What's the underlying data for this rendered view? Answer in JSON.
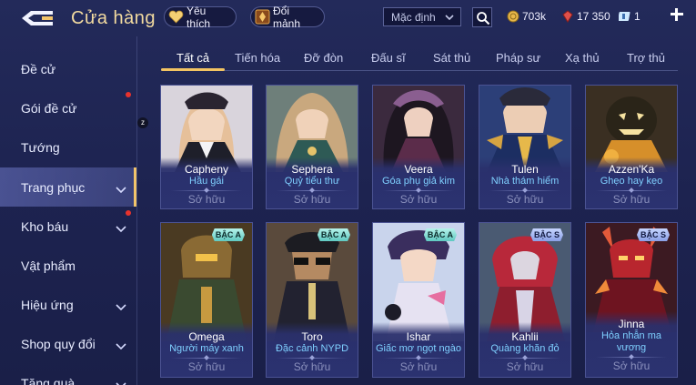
{
  "header": {
    "title": "Cửa hàng",
    "favorites_label": "Yêu thích",
    "exchange_label": "Đổi mảnh",
    "sort_value": "Mặc định",
    "gold": "703k",
    "rubies": "17 350",
    "vouchers": "1"
  },
  "sidebar": {
    "items": [
      {
        "label": "Đề cử"
      },
      {
        "label": "Gói đề cử"
      },
      {
        "label": "Tướng"
      },
      {
        "label": "Trang phục"
      },
      {
        "label": "Kho báu"
      },
      {
        "label": "Vật phẩm"
      },
      {
        "label": "Hiệu ứng"
      },
      {
        "label": "Shop quy đổi"
      },
      {
        "label": "Tặng quà"
      }
    ],
    "z_badge": "z"
  },
  "tabs": [
    {
      "label": "Tất cả"
    },
    {
      "label": "Tiến hóa"
    },
    {
      "label": "Đỡ đòn"
    },
    {
      "label": "Đấu sĩ"
    },
    {
      "label": "Sát thủ"
    },
    {
      "label": "Pháp sư"
    },
    {
      "label": "Xạ thủ"
    },
    {
      "label": "Trợ thủ"
    }
  ],
  "cards": [
    {
      "hero": "Capheny",
      "skin": "Hầu gái",
      "status": "Sở hữu",
      "badge": ""
    },
    {
      "hero": "Sephera",
      "skin": "Quỷ tiểu thư",
      "status": "Sở hữu",
      "badge": ""
    },
    {
      "hero": "Veera",
      "skin": "Góa phụ giả kim",
      "status": "Sở hữu",
      "badge": ""
    },
    {
      "hero": "Tulen",
      "skin": "Nhà thám hiểm",
      "status": "Sở hữu",
      "badge": ""
    },
    {
      "hero": "Azzen'Ka",
      "skin": "Ghẹo hay kẹo",
      "status": "Sở hữu",
      "badge": ""
    },
    {
      "hero": "Omega",
      "skin": "Người máy xanh",
      "status": "Sở hữu",
      "badge": "BẬC A"
    },
    {
      "hero": "Toro",
      "skin": "Đặc cảnh NYPD",
      "status": "Sở hữu",
      "badge": "BẬC A"
    },
    {
      "hero": "Ishar",
      "skin": "Giấc mơ ngọt ngào",
      "status": "Sở hữu",
      "badge": "BẬC A"
    },
    {
      "hero": "Kahlii",
      "skin": "Quàng khăn đỏ",
      "status": "Sở hữu",
      "badge": "BẬC S"
    },
    {
      "hero": "Jinna",
      "skin": "Hỏa nhẫn ma vương",
      "status": "Sở hữu",
      "badge": "BẬC S"
    }
  ]
}
